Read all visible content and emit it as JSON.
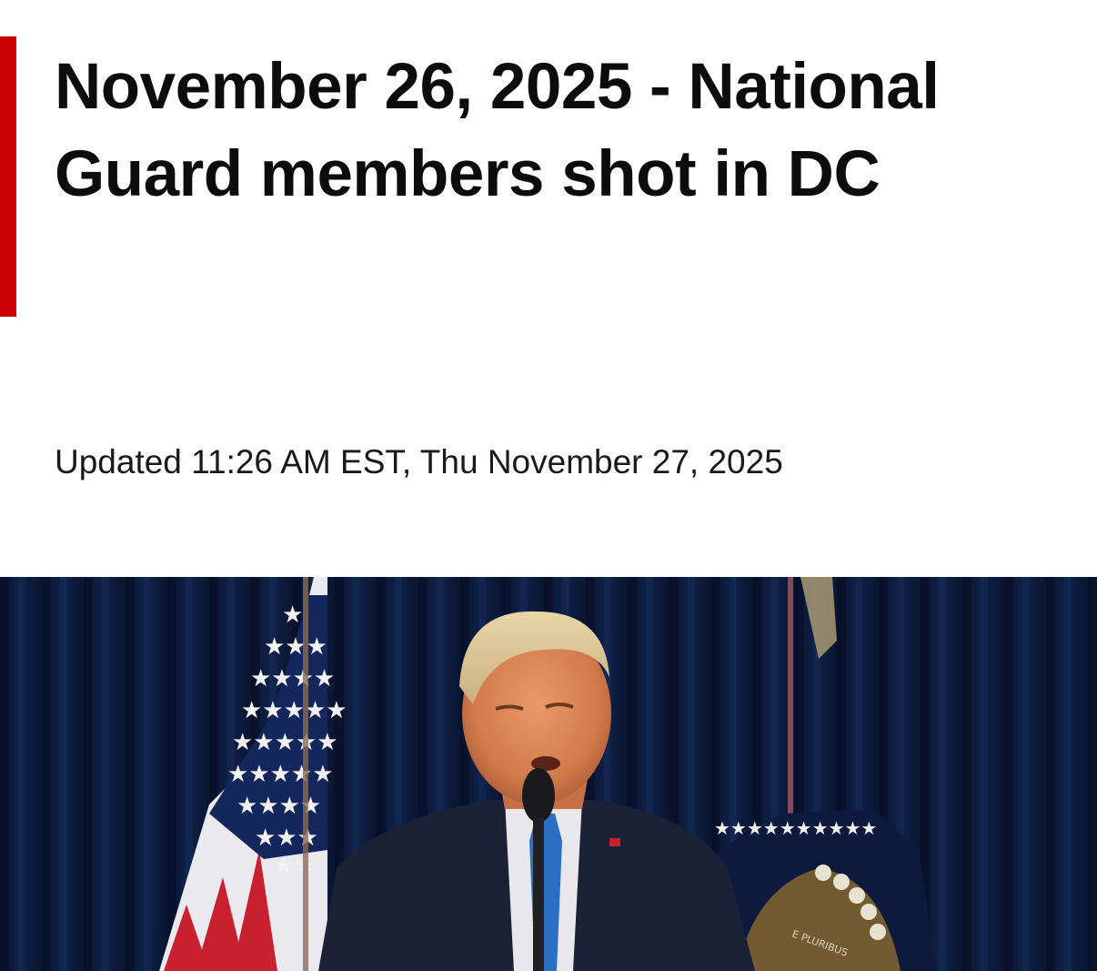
{
  "article": {
    "headline": "November 26, 2025 - National Guard members shot in DC",
    "timestamp": "Updated 11:26 AM EST, Thu November 27, 2025"
  },
  "hero_image": {
    "subject": "speaker at podium microphone with flags",
    "seal_text": "E PLURIBUS"
  },
  "colors": {
    "accent": "#cc0000",
    "headline": "#0c0c0c",
    "curtain": "#0c1a3d"
  }
}
